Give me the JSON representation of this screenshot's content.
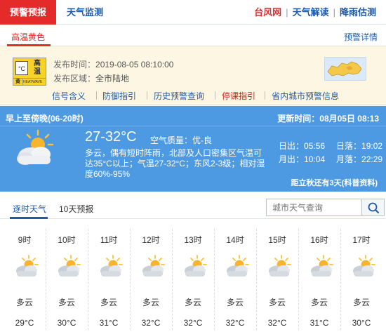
{
  "topbar": {
    "active_tab": "预警预报",
    "monitor_tab": "天气监测",
    "links": [
      "台风网",
      "天气解读",
      "降雨估测"
    ]
  },
  "warning": {
    "tab_title": "高温黄色",
    "detail_link": "预警详情",
    "icon": {
      "name": "high-temp-yellow-warning-icon",
      "char1": "高",
      "char2": "温",
      "therm": "°C",
      "level": "黄",
      "english": "HEATWAVE"
    },
    "publish_time_label": "发布时间：",
    "publish_time": "2019-08-05 08:10:00",
    "publish_area_label": "发布区域：",
    "publish_area": "全市陆地",
    "links": [
      "信号含义",
      "防御指引",
      "历史预警查询",
      "停课指引",
      "省内城市预警信息"
    ]
  },
  "now": {
    "period": "早上至傍晚(06-20时)",
    "update": "更新时间：08月05日 08:13",
    "temp": "27-32°C",
    "air_quality": "空气质量：优-良",
    "description": "多云，偶有短时阵雨，北部及人口密集区气温可达35°C以上；气温27-32°C；东风2-3级；相对湿度60%-95%",
    "sunrise_label": "日出：",
    "sunrise": "05:56",
    "sunset_label": "日落：",
    "sunset": "19:02",
    "moonrise_label": "月出：",
    "moonrise": "10:04",
    "moonset_label": "月落：",
    "moonset": "22:29",
    "autumn": "距立秋还有3天(科普资料)",
    "icon": "partly-cloudy-icon"
  },
  "forecast_tabs": {
    "hourly": "逐时天气",
    "ten_day": "10天预报",
    "search_placeholder": "城市天气查询"
  },
  "hourly": [
    {
      "time": "9时",
      "weather": "多云",
      "temp": "29°C"
    },
    {
      "time": "10时",
      "weather": "多云",
      "temp": "30°C"
    },
    {
      "time": "11时",
      "weather": "多云",
      "temp": "31°C"
    },
    {
      "time": "12时",
      "weather": "多云",
      "temp": "32°C"
    },
    {
      "time": "13时",
      "weather": "多云",
      "temp": "32°C"
    },
    {
      "time": "14时",
      "weather": "多云",
      "temp": "32°C"
    },
    {
      "time": "15时",
      "weather": "多云",
      "temp": "32°C"
    },
    {
      "time": "16时",
      "weather": "多云",
      "temp": "31°C"
    },
    {
      "time": "17时",
      "weather": "多云",
      "temp": "30°C"
    }
  ],
  "colors": {
    "accent_red": "#e52a2a",
    "link_blue": "#1f5aa6",
    "panel_blue": "#4e9ae2",
    "warn_bg": "#fdf6e3"
  }
}
